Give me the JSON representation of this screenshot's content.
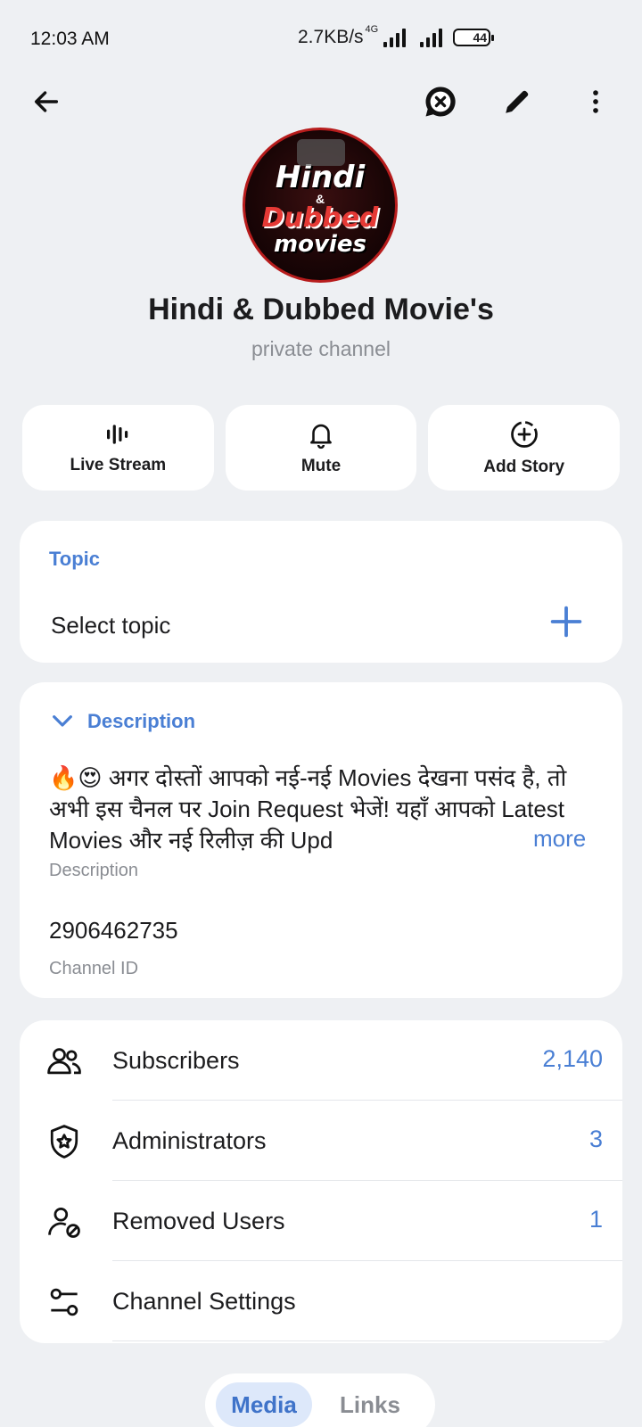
{
  "status_bar": {
    "time": "12:03 AM",
    "network_speed": "2.7KB/s",
    "network_type": "4G",
    "battery": "44"
  },
  "toolbar": {
    "back_icon": "arrow-left-icon",
    "stop_icon": "close-speech-bubble-icon",
    "edit_icon": "pencil-icon",
    "more_icon": "more-vertical-icon"
  },
  "channel": {
    "avatar_text": {
      "line1": "Hindi",
      "amp": "&",
      "line2": "Dubbed",
      "line3": "movies"
    },
    "title": "Hindi & Dubbed Movie's",
    "subtitle": "private channel"
  },
  "actions": [
    {
      "label": "Live Stream",
      "icon": "live-stream-icon"
    },
    {
      "label": "Mute",
      "icon": "bell-icon"
    },
    {
      "label": "Add Story",
      "icon": "add-story-icon"
    }
  ],
  "topic": {
    "label": "Topic",
    "placeholder": "Select topic"
  },
  "description": {
    "label": "Description",
    "text": "🔥😍 अगर दोस्तों आपको नई-नई Movies देखना पसंद है, तो अभी इस चैनल पर Join Request भेजें! यहाँ आपको Latest Movies और नई रिलीज़ की Upd",
    "more": "more",
    "caption": "Description"
  },
  "channel_id": {
    "value": "2906462735",
    "caption": "Channel ID"
  },
  "list": [
    {
      "label": "Subscribers",
      "count": "2,140",
      "icon": "users-icon"
    },
    {
      "label": "Administrators",
      "count": "3",
      "icon": "shield-star-icon"
    },
    {
      "label": "Removed Users",
      "count": "1",
      "icon": "user-blocked-icon"
    },
    {
      "label": "Channel Settings",
      "count": "",
      "icon": "settings-sliders-icon"
    }
  ],
  "tabs": {
    "media": "Media",
    "links": "Links"
  },
  "colors": {
    "accent": "#4a7fd4",
    "background": "#eef0f3",
    "card": "#ffffff"
  }
}
